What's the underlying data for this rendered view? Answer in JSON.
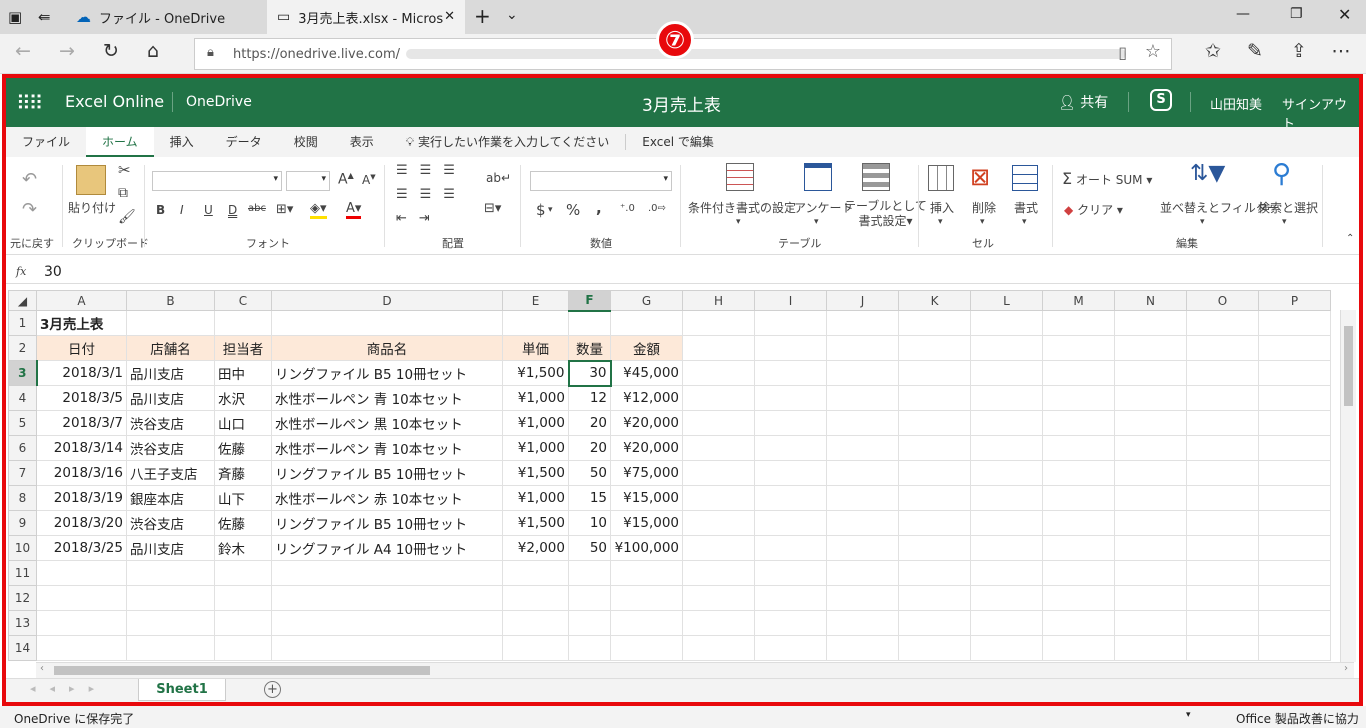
{
  "browser": {
    "tabs": [
      {
        "label": "ファイル - OneDrive"
      },
      {
        "label": "3月売上表.xlsx - Micros"
      }
    ],
    "url": "https://onedrive.live.com/"
  },
  "annotation": {
    "badge": "⑦"
  },
  "app": {
    "name": "Excel Online",
    "location": "OneDrive",
    "doc_title": "3月売上表",
    "share_label": "共有",
    "user_name": "山田知美",
    "signout": "サインアウト"
  },
  "ribbon": {
    "tabs": [
      "ファイル",
      "ホーム",
      "挿入",
      "データ",
      "校閲",
      "表示"
    ],
    "active_tab": "ホーム",
    "tell_me": "実行したい作業を入力してください",
    "edit_in_excel": "Excel で編集",
    "groups": {
      "undo": "元に戻す",
      "clipboard": "クリップボード",
      "font": "フォント",
      "align": "配置",
      "number": "数値",
      "table": "テーブル",
      "cells": "セル",
      "edit": "編集"
    },
    "paste": "貼り付け",
    "cond_format": "条件付き書式の設定",
    "survey": "アンケート",
    "format_table_1": "テーブルとして",
    "format_table_2": "書式設定",
    "insert": "挿入",
    "delete": "削除",
    "format": "書式",
    "autosum": "オート SUM",
    "clear": "クリア",
    "sort_filter": "並べ替えとフィルター",
    "find_select": "検索と選択",
    "currency": "$",
    "percent": "%",
    "comma": ",",
    "bold": "B",
    "italic": "I",
    "underline": "U",
    "double_underline": "D",
    "strike": "abc"
  },
  "formula": {
    "fx": "fx",
    "value": "30"
  },
  "sheet": {
    "columns": [
      "A",
      "B",
      "C",
      "D",
      "E",
      "F",
      "G",
      "H",
      "I",
      "J",
      "K",
      "L",
      "M",
      "N",
      "O",
      "P"
    ],
    "row_numbers": [
      "1",
      "2",
      "3",
      "4",
      "5",
      "6",
      "7",
      "8",
      "9",
      "10",
      "11",
      "12",
      "13",
      "14"
    ],
    "title": "3月売上表",
    "headers": [
      "日付",
      "店舗名",
      "担当者",
      "商品名",
      "単価",
      "数量",
      "金額"
    ],
    "rows": [
      [
        "2018/3/1",
        "品川支店",
        "田中",
        "リングファイル B5 10冊セット",
        "¥1,500",
        "30",
        "¥45,000"
      ],
      [
        "2018/3/5",
        "品川支店",
        "水沢",
        "水性ボールペン 青 10本セット",
        "¥1,000",
        "12",
        "¥12,000"
      ],
      [
        "2018/3/7",
        "渋谷支店",
        "山口",
        "水性ボールペン 黒 10本セット",
        "¥1,000",
        "20",
        "¥20,000"
      ],
      [
        "2018/3/14",
        "渋谷支店",
        "佐藤",
        "水性ボールペン 青 10本セット",
        "¥1,000",
        "20",
        "¥20,000"
      ],
      [
        "2018/3/16",
        "八王子支店",
        "斉藤",
        "リングファイル B5 10冊セット",
        "¥1,500",
        "50",
        "¥75,000"
      ],
      [
        "2018/3/19",
        "銀座本店",
        "山下",
        "水性ボールペン 赤 10本セット",
        "¥1,000",
        "15",
        "¥15,000"
      ],
      [
        "2018/3/20",
        "渋谷支店",
        "佐藤",
        "リングファイル B5 10冊セット",
        "¥1,500",
        "10",
        "¥15,000"
      ],
      [
        "2018/3/25",
        "品川支店",
        "鈴木",
        "リングファイル A4 10冊セット",
        "¥2,000",
        "50",
        "¥100,000"
      ]
    ],
    "tab_name": "Sheet1"
  },
  "status": {
    "left": "OneDrive に保存完了",
    "right": "Office 製品改善に協力"
  },
  "colors": {
    "excel_green": "#217346",
    "header_fill": "#fde9d9",
    "frame_red": "#e8090c"
  }
}
